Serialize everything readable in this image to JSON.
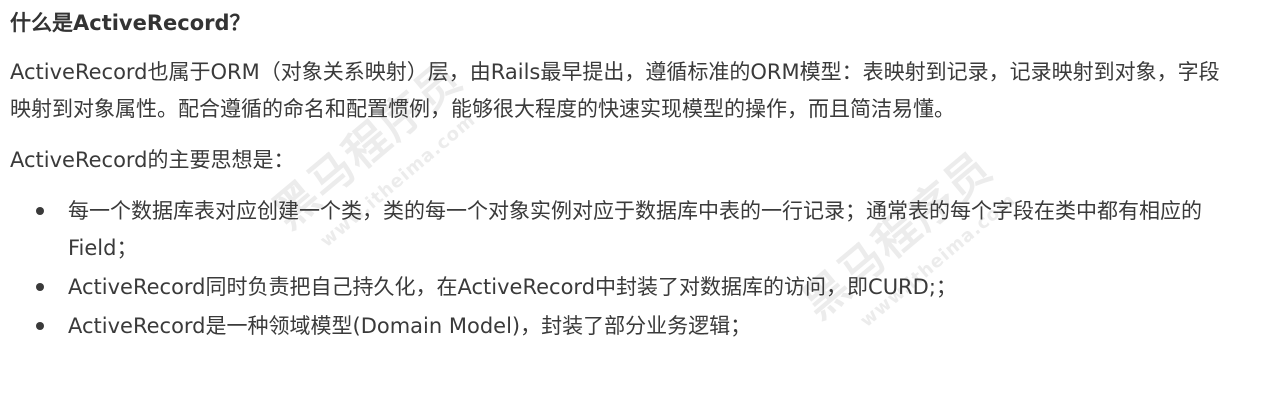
{
  "heading": "什么是ActiveRecord？",
  "paragraphs": [
    "ActiveRecord也属于ORM（对象关系映射）层，由Rails最早提出，遵循标准的ORM模型：表映射到记录，记录映射到对象，字段映射到对象属性。配合遵循的命名和配置惯例，能够很大程度的快速实现模型的操作，而且简洁易懂。",
    "ActiveRecord的主要思想是："
  ],
  "bullets": [
    "每一个数据库表对应创建一个类，类的每一个对象实例对应于数据库中表的一行记录；通常表的每个字段在类中都有相应的Field；",
    "ActiveRecord同时负责把自己持久化，在ActiveRecord中封装了对数据库的访问，即CURD;；",
    "ActiveRecord是一种领域模型(Domain Model)，封装了部分业务逻辑；"
  ],
  "watermark": {
    "brand": "黑马程序员",
    "url": "www.itheima.com"
  }
}
